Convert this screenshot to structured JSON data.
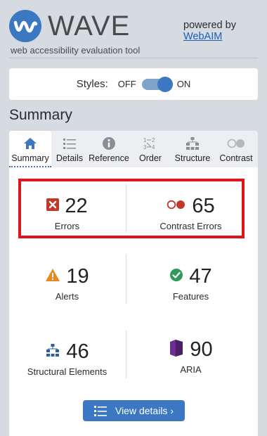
{
  "header": {
    "logo_text": "WAVE",
    "tagline": "web accessibility evaluation tool",
    "powered_by": "powered by",
    "powered_link": "WebAIM"
  },
  "styles_toggle": {
    "label": "Styles:",
    "off": "OFF",
    "on": "ON",
    "state": "on"
  },
  "summary_heading": "Summary",
  "tabs": [
    {
      "label": "Summary",
      "icon": "home-icon",
      "active": true
    },
    {
      "label": "Details",
      "icon": "list-icon",
      "active": false
    },
    {
      "label": "Reference",
      "icon": "info-icon",
      "active": false
    },
    {
      "label": "Order",
      "icon": "order-icon",
      "active": false
    },
    {
      "label": "Structure",
      "icon": "structure-icon",
      "active": false
    },
    {
      "label": "Contrast",
      "icon": "contrast-icon",
      "active": false
    }
  ],
  "stats": {
    "errors": {
      "count": "22",
      "label": "Errors",
      "icon": "error-icon"
    },
    "contrast_errors": {
      "count": "65",
      "label": "Contrast Errors",
      "icon": "contrast-error-icon"
    },
    "alerts": {
      "count": "19",
      "label": "Alerts",
      "icon": "alert-icon"
    },
    "features": {
      "count": "47",
      "label": "Features",
      "icon": "feature-icon"
    },
    "structural": {
      "count": "46",
      "label": "Structural Elements",
      "icon": "structure-icon"
    },
    "aria": {
      "count": "90",
      "label": "ARIA",
      "icon": "aria-icon"
    }
  },
  "view_details_button": "View details ›",
  "colors": {
    "brand_blue": "#3b78c1",
    "error_red": "#c0392b",
    "highlight_red": "#e0151c",
    "alert_orange": "#e6891e",
    "feature_green": "#2f9a5a",
    "aria_purple": "#6b2e8f"
  }
}
